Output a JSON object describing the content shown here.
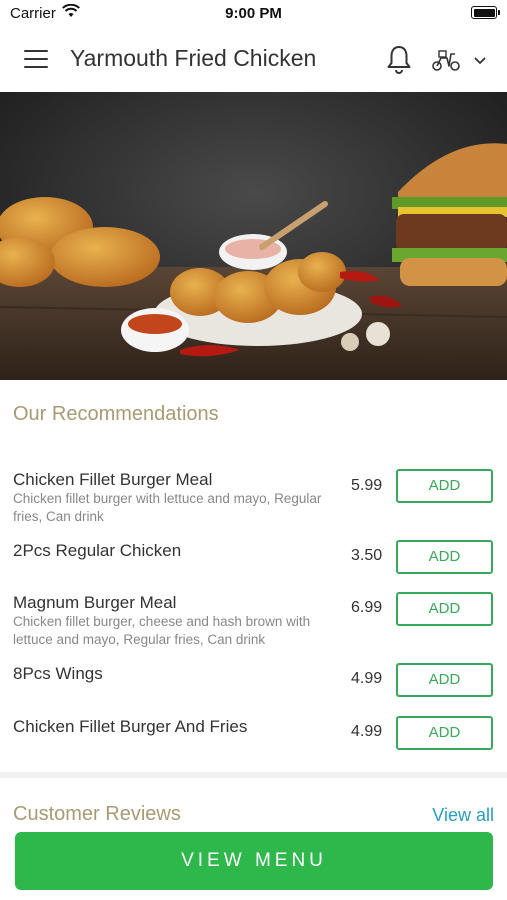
{
  "status_bar": {
    "carrier": "Carrier",
    "time": "9:00 PM"
  },
  "header": {
    "title": "Yarmouth Fried Chicken"
  },
  "recommendations": {
    "title": "Our Recommendations",
    "add_label": "ADD",
    "items": [
      {
        "name": "Chicken Fillet Burger Meal",
        "description": "Chicken fillet burger with lettuce and mayo, Regular fries, Can drink",
        "price": "5.99"
      },
      {
        "name": "2Pcs Regular Chicken",
        "description": "",
        "price": "3.50"
      },
      {
        "name": "Magnum Burger Meal",
        "description": "Chicken fillet burger, cheese and hash brown with lettuce and mayo, Regular fries,  Can drink",
        "price": "6.99"
      },
      {
        "name": "8Pcs Wings",
        "description": "",
        "price": "4.99"
      },
      {
        "name": "Chicken Fillet Burger And Fries",
        "description": "",
        "price": "4.99"
      }
    ]
  },
  "reviews": {
    "title": "Customer Reviews",
    "view_all": "View all"
  },
  "footer": {
    "view_menu": "VIEW MENU"
  },
  "colors": {
    "accent_green": "#2eb84b",
    "section_title": "#a89a73",
    "link_blue": "#2a9dc4"
  }
}
